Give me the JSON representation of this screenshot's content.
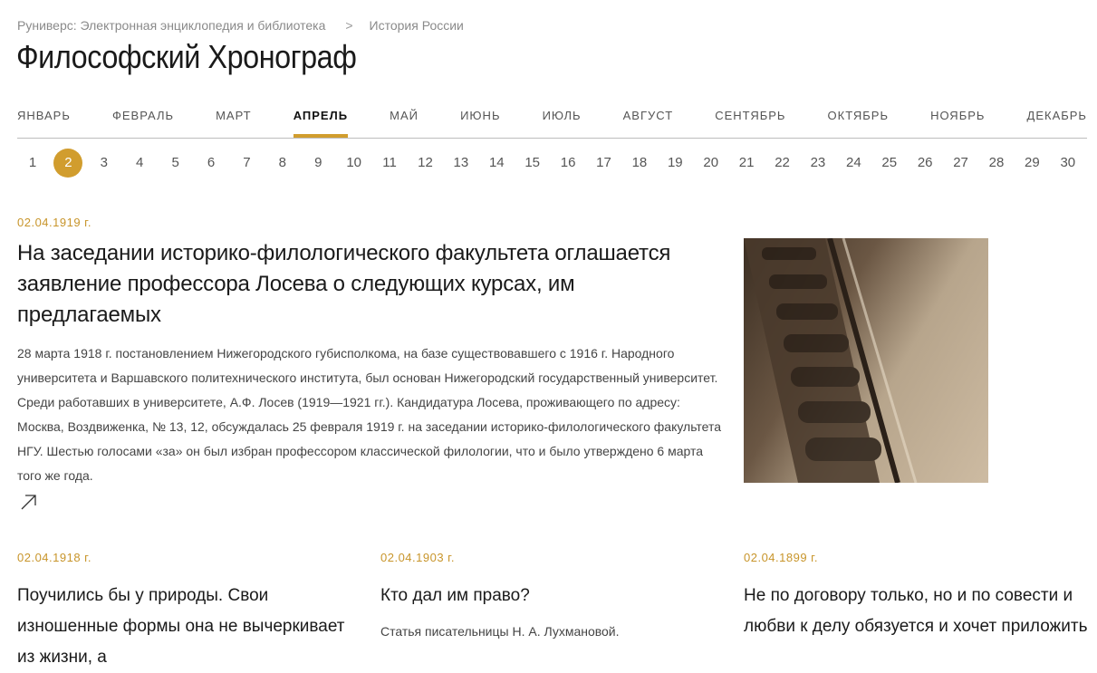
{
  "breadcrumb": {
    "items": [
      "Руниверс: Электронная энциклопедия и библиотека",
      "История России"
    ],
    "separator": ">"
  },
  "page_title": "Философский Хронограф",
  "months": [
    "ЯНВАРЬ",
    "ФЕВРАЛЬ",
    "МАРТ",
    "АПРЕЛЬ",
    "МАЙ",
    "ИЮНЬ",
    "ИЮЛЬ",
    "АВГУСТ",
    "СЕНТЯБРЬ",
    "ОКТЯБРЬ",
    "НОЯБРЬ",
    "ДЕКАБРЬ"
  ],
  "active_month": "АПРЕЛЬ",
  "days": [
    "1",
    "2",
    "3",
    "4",
    "5",
    "6",
    "7",
    "8",
    "9",
    "10",
    "11",
    "12",
    "13",
    "14",
    "15",
    "16",
    "17",
    "18",
    "19",
    "20",
    "21",
    "22",
    "23",
    "24",
    "25",
    "26",
    "27",
    "28",
    "29",
    "30"
  ],
  "active_day": "2",
  "accent_color": "#d19d2e",
  "featured": {
    "date": "02.04.1919 г.",
    "title": "На заседании историко-филологического факультета оглашается заявление профессора Лосева о следующих курсах, им предлагаемых",
    "text": "28 марта 1918 г. постановлением Нижегородского губисполкома, на базе существовавшего с 1916 г. Народного университета и Варшавского политехнического института, был основан Нижегородский государственный университет. Среди работавших в университете, А.Ф. Лосев (1919—1921 гг.). Кандидатура Лосева, проживающего по адресу: Москва, Воздвиженка, № 13, 12, обсуждалась 25 февраля 1919 г. на заседании историко-филологического факультета НГУ. Шестью голосами «за» он был избран профессором классической филологии, что и было утверждено 6 марта того же года.",
    "link_icon": "arrow-up-right-icon"
  },
  "articles": [
    {
      "date": "02.04.1918 г.",
      "title": "Поучились бы у природы. Свои изношенные формы она не вычеркивает из жизни, а",
      "text": ""
    },
    {
      "date": "02.04.1903 г.",
      "title": "Кто дал им право?",
      "text": "Статья писательницы Н. А. Лухмановой."
    },
    {
      "date": "02.04.1899 г.",
      "title": "Не по договору только, но и по совести и любви к делу обязуется и хочет приложить",
      "text": ""
    }
  ]
}
